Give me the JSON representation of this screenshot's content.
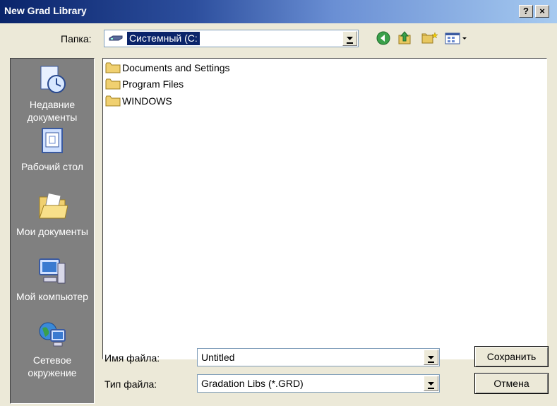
{
  "window": {
    "title": "New Grad Library",
    "help_label": "?",
    "close_label": "×"
  },
  "lookin": {
    "label": "Папка:",
    "value": "Системный (C:"
  },
  "places": [
    {
      "label": "Недавние документы",
      "icon": "recent-documents-icon"
    },
    {
      "label": "Рабочий стол",
      "icon": "desktop-icon"
    },
    {
      "label": "Мои документы",
      "icon": "my-documents-icon"
    },
    {
      "label": "Мой компьютер",
      "icon": "my-computer-icon"
    },
    {
      "label": "Сетевое окружение",
      "icon": "network-icon"
    }
  ],
  "files": [
    {
      "name": "Documents and Settings",
      "icon": "folder-icon"
    },
    {
      "name": "Program Files",
      "icon": "folder-icon"
    },
    {
      "name": "WINDOWS",
      "icon": "folder-icon"
    }
  ],
  "filename": {
    "label": "Имя файла:",
    "value": "Untitled"
  },
  "filetype": {
    "label": "Тип файла:",
    "value": "Gradation Libs (*.GRD)"
  },
  "buttons": {
    "save": "Сохранить",
    "cancel": "Отмена"
  }
}
